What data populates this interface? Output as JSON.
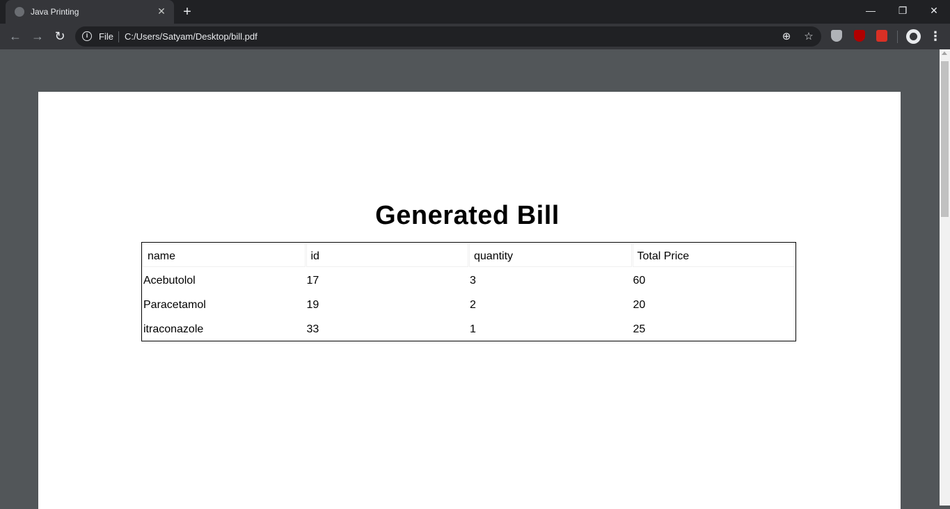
{
  "browser": {
    "tab_title": "Java Printing",
    "tab_close": "✕",
    "new_tab": "+",
    "window": {
      "minimize": "—",
      "restore": "❐",
      "close": "✕"
    }
  },
  "toolbar": {
    "back": "←",
    "forward": "→",
    "reload": "↻",
    "scheme_label": "File",
    "url": "C:/Users/Satyam/Desktop/bill.pdf",
    "zoom": "⊕",
    "bookmark": "☆",
    "menu": "⋮",
    "colors": {
      "brave_shield": "#b0b3b8",
      "ublock": "#b00000",
      "bookmark_ext": "#d93025"
    }
  },
  "document": {
    "title": "Generated Bill",
    "columns": [
      "name",
      "id",
      "quantity",
      "Total Price"
    ],
    "rows": [
      [
        "Acebutolol",
        "17",
        "3",
        "60"
      ],
      [
        "Paracetamol",
        "19",
        "2",
        "20"
      ],
      [
        "itraconazole",
        "33",
        "1",
        "25"
      ]
    ]
  }
}
